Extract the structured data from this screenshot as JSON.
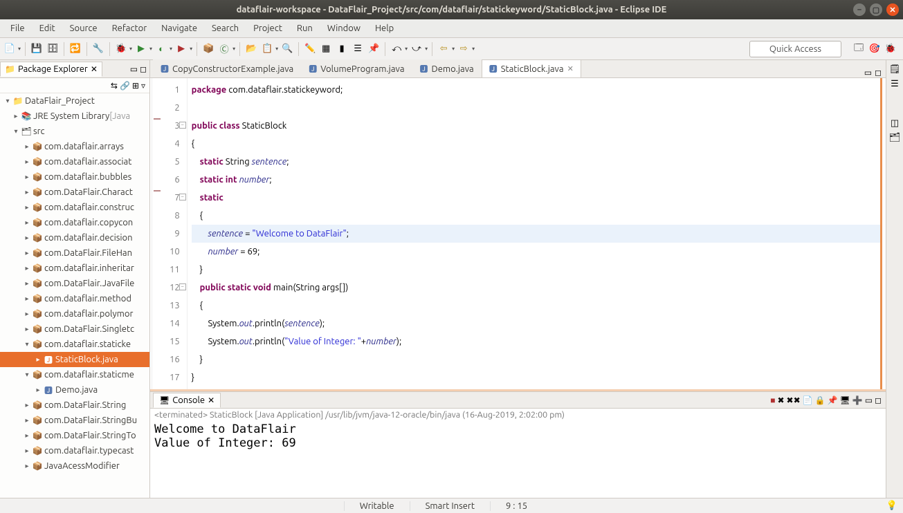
{
  "window_title": "dataflair-workspace - DataFlair_Project/src/com/dataflair/statickeyword/StaticBlock.java - Eclipse IDE",
  "menubar": [
    "File",
    "Edit",
    "Source",
    "Refactor",
    "Navigate",
    "Search",
    "Project",
    "Run",
    "Window",
    "Help"
  ],
  "quick_access": "Quick Access",
  "pkg_explorer": {
    "title": "Package Explorer",
    "items": [
      {
        "depth": 0,
        "exp": "▾",
        "icon": "📁",
        "cls": "prj-icon",
        "label": "DataFlair_Project"
      },
      {
        "depth": 1,
        "exp": "▸",
        "icon": "📚",
        "cls": "",
        "label": "JRE System Library ",
        "decor": "[Java"
      },
      {
        "depth": 1,
        "exp": "▾",
        "icon": "🗂",
        "cls": "",
        "label": "src"
      },
      {
        "depth": 2,
        "exp": "▸",
        "icon": "📦",
        "cls": "pkg-icon",
        "label": "com.dataflair.arrays"
      },
      {
        "depth": 2,
        "exp": "▸",
        "icon": "📦",
        "cls": "pkg-icon",
        "label": "com.dataflair.associat"
      },
      {
        "depth": 2,
        "exp": "▸",
        "icon": "📦",
        "cls": "pkg-icon",
        "label": "com.dataflair.bubbles"
      },
      {
        "depth": 2,
        "exp": "▸",
        "icon": "📦",
        "cls": "pkg-icon",
        "label": "com.DataFlair.Charact"
      },
      {
        "depth": 2,
        "exp": "▸",
        "icon": "📦",
        "cls": "pkg-icon",
        "label": "com.dataflair.construc"
      },
      {
        "depth": 2,
        "exp": "▸",
        "icon": "📦",
        "cls": "pkg-icon",
        "label": "com.dataflair.copycon"
      },
      {
        "depth": 2,
        "exp": "▸",
        "icon": "📦",
        "cls": "pkg-icon",
        "label": "com.dataflair.decision"
      },
      {
        "depth": 2,
        "exp": "▸",
        "icon": "📦",
        "cls": "pkg-icon",
        "label": "com.DataFlair.FileHan"
      },
      {
        "depth": 2,
        "exp": "▸",
        "icon": "📦",
        "cls": "pkg-icon",
        "label": "com.dataflair.inheritar"
      },
      {
        "depth": 2,
        "exp": "▸",
        "icon": "📦",
        "cls": "pkg-icon",
        "label": "com.DataFlair.JavaFile"
      },
      {
        "depth": 2,
        "exp": "▸",
        "icon": "📦",
        "cls": "pkg-icon",
        "label": "com.dataflair.method"
      },
      {
        "depth": 2,
        "exp": "▸",
        "icon": "📦",
        "cls": "pkg-icon",
        "label": "com.dataflair.polymor"
      },
      {
        "depth": 2,
        "exp": "▸",
        "icon": "📦",
        "cls": "pkg-icon",
        "label": "com.DataFlair.Singletc"
      },
      {
        "depth": 2,
        "exp": "▾",
        "icon": "📦",
        "cls": "pkg-icon",
        "label": "com.dataflair.staticke"
      },
      {
        "depth": 3,
        "exp": "▸",
        "icon": "🅹",
        "cls": "file-icon",
        "label": "StaticBlock.java",
        "sel": true
      },
      {
        "depth": 2,
        "exp": "▾",
        "icon": "📦",
        "cls": "pkg-icon",
        "label": "com.dataflair.staticme"
      },
      {
        "depth": 3,
        "exp": "▸",
        "icon": "🅹",
        "cls": "file-icon",
        "label": "Demo.java"
      },
      {
        "depth": 2,
        "exp": "▸",
        "icon": "📦",
        "cls": "pkg-icon",
        "label": "com.DataFlair.String"
      },
      {
        "depth": 2,
        "exp": "▸",
        "icon": "📦",
        "cls": "pkg-icon",
        "label": "com.DataFlair.StringBu"
      },
      {
        "depth": 2,
        "exp": "▸",
        "icon": "📦",
        "cls": "pkg-icon",
        "label": "com.DataFlair.StringTo"
      },
      {
        "depth": 2,
        "exp": "▸",
        "icon": "📦",
        "cls": "pkg-icon",
        "label": "com.dataflair.typecast"
      },
      {
        "depth": 2,
        "exp": "▸",
        "icon": "📦",
        "cls": "pkg-icon",
        "label": "JavaAcessModifier"
      }
    ]
  },
  "editor_tabs": [
    {
      "label": "CopyConstructorExample.java",
      "active": false
    },
    {
      "label": "VolumeProgram.java",
      "active": false
    },
    {
      "label": "Demo.java",
      "active": false
    },
    {
      "label": "StaticBlock.java",
      "active": true
    }
  ],
  "code_lines": [
    {
      "n": 1,
      "html": "<span class='kw'>package</span> com.dataflair.statickeyword;"
    },
    {
      "n": 2,
      "html": ""
    },
    {
      "n": 3,
      "html": "<span class='kw'>public</span> <span class='kw'>class</span> StaticBlock",
      "fold": true
    },
    {
      "n": 4,
      "html": "{"
    },
    {
      "n": 5,
      "html": "    <span class='kw'>static</span> String <span class='field'>sentence</span>;"
    },
    {
      "n": 6,
      "html": "    <span class='kw'>static</span> <span class='kw'>int</span> <span class='field'>number</span>;"
    },
    {
      "n": 7,
      "html": "    <span class='kw'>static</span>",
      "fold": true
    },
    {
      "n": 8,
      "html": "    {"
    },
    {
      "n": 9,
      "html": "        <span class='field'>sentence</span> = <span class='str'>\"Welcome to DataFlair\"</span>;",
      "hilite": true
    },
    {
      "n": 10,
      "html": "        <span class='field'>number</span> = 69;"
    },
    {
      "n": 11,
      "html": "    }"
    },
    {
      "n": 12,
      "html": "    <span class='kw'>public</span> <span class='kw'>static</span> <span class='kw'>void</span> main(String args[])",
      "fold": true
    },
    {
      "n": 13,
      "html": "    {"
    },
    {
      "n": 14,
      "html": "        System.<span class='field'>out</span>.println(<span class='field'>sentence</span>);"
    },
    {
      "n": 15,
      "html": "        System.<span class='field'>out</span>.println(<span class='str'>\"Value of Integer: \"</span>+<span class='field'>number</span>);"
    },
    {
      "n": 16,
      "html": "    }"
    },
    {
      "n": 17,
      "html": "}"
    }
  ],
  "console": {
    "title": "Console",
    "header": "<terminated> StaticBlock [Java Application] /usr/lib/jvm/java-12-oracle/bin/java (16-Aug-2019, 2:02:00 pm)",
    "out": "Welcome to DataFlair\nValue of Integer: 69"
  },
  "status": {
    "writable": "Writable",
    "insert": "Smart Insert",
    "pos": "9 : 15"
  }
}
